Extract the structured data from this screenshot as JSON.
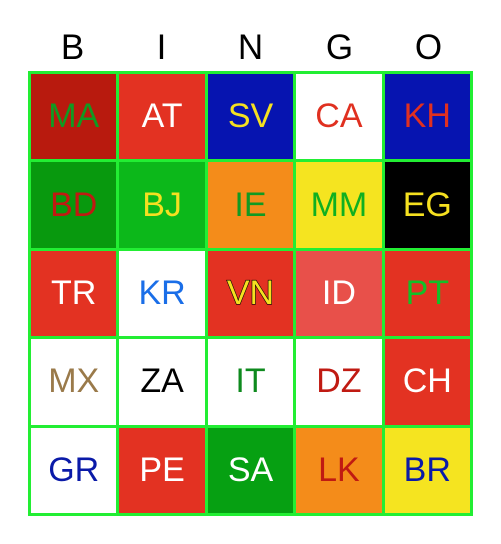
{
  "header": {
    "letters": [
      "B",
      "I",
      "N",
      "G",
      "O"
    ]
  },
  "colors": {
    "grid_line": "#22ee33"
  },
  "board": {
    "cells": [
      {
        "label": "MA",
        "bg": "#b81a0e",
        "fg": "#119a22"
      },
      {
        "label": "AT",
        "bg": "#e33222",
        "fg": "#ffffff"
      },
      {
        "label": "SV",
        "bg": "#0614b0",
        "fg": "#f5e020"
      },
      {
        "label": "CA",
        "bg": "#ffffff",
        "fg": "#e03020"
      },
      {
        "label": "KH",
        "bg": "#0614b0",
        "fg": "#e03020"
      },
      {
        "label": "BD",
        "bg": "#08990e",
        "fg": "#c01a12"
      },
      {
        "label": "BJ",
        "bg": "#0cb81a",
        "fg": "#f5e020"
      },
      {
        "label": "IE",
        "bg": "#f48c1a",
        "fg": "#119a22"
      },
      {
        "label": "MM",
        "bg": "#f5e420",
        "fg": "#10b020"
      },
      {
        "label": "EG",
        "bg": "#000000",
        "fg": "#f5e020"
      },
      {
        "label": "TR",
        "bg": "#e33222",
        "fg": "#ffffff"
      },
      {
        "label": "KR",
        "bg": "#ffffff",
        "fg": "#1a6ee8"
      },
      {
        "label": "VN",
        "bg": "#e33222",
        "fg": "#f5e020",
        "outlined": true
      },
      {
        "label": "ID",
        "bg": "#e8504a",
        "fg": "#ffffff"
      },
      {
        "label": "PT",
        "bg": "#e33222",
        "fg": "#12c028"
      },
      {
        "label": "MX",
        "bg": "#ffffff",
        "fg": "#9a7a4a"
      },
      {
        "label": "ZA",
        "bg": "#ffffff",
        "fg": "#000000"
      },
      {
        "label": "IT",
        "bg": "#ffffff",
        "fg": "#0e8a1e"
      },
      {
        "label": "DZ",
        "bg": "#ffffff",
        "fg": "#c01a12"
      },
      {
        "label": "CH",
        "bg": "#e33222",
        "fg": "#ffffff"
      },
      {
        "label": "GR",
        "bg": "#ffffff",
        "fg": "#0a1aa8"
      },
      {
        "label": "PE",
        "bg": "#e33222",
        "fg": "#ffffff"
      },
      {
        "label": "SA",
        "bg": "#06a012",
        "fg": "#ffffff"
      },
      {
        "label": "LK",
        "bg": "#f48c1a",
        "fg": "#c01a12"
      },
      {
        "label": "BR",
        "bg": "#f5e420",
        "fg": "#0a1aa8"
      }
    ]
  }
}
